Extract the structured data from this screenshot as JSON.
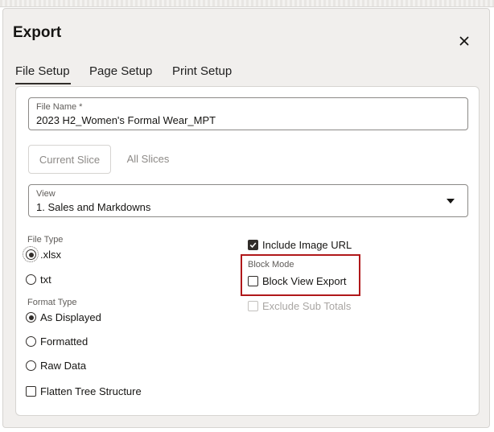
{
  "dialog": {
    "title": "Export",
    "close_icon": "close-icon"
  },
  "tabs": [
    {
      "label": "File Setup",
      "active": true
    },
    {
      "label": "Page Setup",
      "active": false
    },
    {
      "label": "Print Setup",
      "active": false
    }
  ],
  "file_name": {
    "label": "File Name *",
    "value": "2023 H2_Women's Formal Wear_MPT"
  },
  "slices": {
    "current": "Current Slice",
    "all": "All Slices"
  },
  "view": {
    "label": "View",
    "value": "1. Sales and Markdowns"
  },
  "file_type": {
    "label": "File Type",
    "options": [
      {
        "label": ".xlsx",
        "selected": true
      },
      {
        "label": "txt",
        "selected": false
      }
    ]
  },
  "format_type": {
    "label": "Format Type",
    "options": [
      {
        "label": "As Displayed",
        "selected": true
      },
      {
        "label": "Formatted",
        "selected": false
      },
      {
        "label": "Raw Data",
        "selected": false
      }
    ]
  },
  "flatten": {
    "label": "Flatten Tree Structure",
    "checked": false
  },
  "include_image_url": {
    "label": "Include Image URL",
    "checked": true
  },
  "block_mode": {
    "label": "Block Mode",
    "option_label": "Block View Export",
    "checked": false
  },
  "exclude_sub_totals": {
    "label": "Exclude Sub Totals",
    "checked": false,
    "disabled": true
  },
  "colors": {
    "highlight": "#b0181a",
    "text": "#161513",
    "disabled": "#a9a6a3"
  }
}
